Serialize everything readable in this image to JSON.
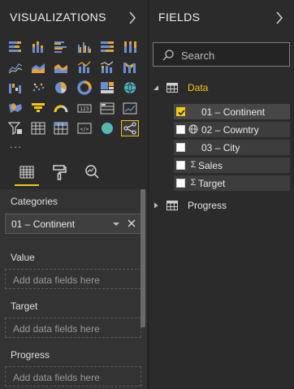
{
  "visualizations": {
    "title": "VISUALIZATIONS",
    "more_label": "...",
    "icons": [
      "stacked-bar-icon",
      "stacked-column-icon",
      "clustered-bar-icon",
      "clustered-column-icon",
      "100-stacked-bar-icon",
      "100-stacked-column-icon",
      "line-chart-icon",
      "area-chart-icon",
      "stacked-area-icon",
      "line-clustered-column-icon",
      "line-stacked-column-icon",
      "ribbon-chart-icon",
      "waterfall-chart-icon",
      "scatter-chart-icon",
      "pie-chart-icon",
      "donut-chart-icon",
      "treemap-icon",
      "map-icon",
      "filled-map-icon",
      "funnel-icon",
      "gauge-icon",
      "card-icon",
      "multi-row-card-icon",
      "kpi-icon",
      "slicer-icon",
      "table-icon",
      "matrix-icon",
      "r-script-icon",
      "globe-icon",
      "network-custom-visual-icon"
    ],
    "selected_index": 29
  },
  "tabs": [
    {
      "name": "fields-tab-icon",
      "active": true
    },
    {
      "name": "format-paint-roller-icon",
      "active": false
    },
    {
      "name": "analytics-magnifier-icon",
      "active": false
    }
  ],
  "wells": {
    "categories": {
      "label": "Categories",
      "value": "01 – Continent"
    },
    "value": {
      "label": "Value",
      "placeholder": "Add data fields here"
    },
    "target": {
      "label": "Target",
      "placeholder": "Add data fields here"
    },
    "progress": {
      "label": "Progress",
      "placeholder": "Add data fields here"
    }
  },
  "fields_pane": {
    "title": "FIELDS",
    "search_placeholder": "Search",
    "tables": [
      {
        "name": "Data",
        "expanded": true,
        "name_color": "#f2c811",
        "fields": [
          {
            "name": "01 – Continent",
            "type": "",
            "checked": true
          },
          {
            "name": "02 – Cowntry",
            "type": "globe",
            "checked": false
          },
          {
            "name": "03 – City",
            "type": "",
            "checked": false
          },
          {
            "name": "Sales",
            "type": "sum",
            "checked": false
          },
          {
            "name": "Target",
            "type": "sum",
            "checked": false
          }
        ]
      },
      {
        "name": "Progress",
        "expanded": false,
        "name_color": "#e8e8e8",
        "fields": []
      }
    ]
  },
  "colors": {
    "accent": "#f2c811",
    "background": "#2b2b2b"
  }
}
